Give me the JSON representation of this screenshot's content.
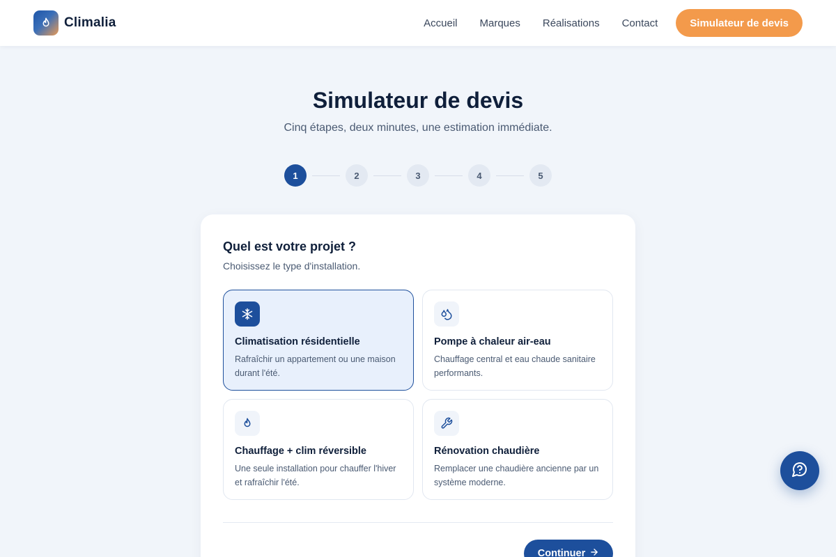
{
  "header": {
    "brand": "Climalia",
    "nav": [
      "Accueil",
      "Marques",
      "Réalisations",
      "Contact"
    ],
    "cta": "Simulateur de devis"
  },
  "hero": {
    "title": "Simulateur de devis",
    "subtitle": "Cinq étapes, deux minutes, une estimation immédiate."
  },
  "stepper": {
    "steps": [
      "1",
      "2",
      "3",
      "4",
      "5"
    ],
    "current": 1
  },
  "form": {
    "question": "Quel est votre projet ?",
    "hint": "Choisissez le type d'installation.",
    "options": [
      {
        "icon": "snowflake-icon",
        "title": "Climatisation résidentielle",
        "desc": "Rafraîchir un appartement ou une maison durant l'été.",
        "selected": true
      },
      {
        "icon": "water-drops-icon",
        "title": "Pompe à chaleur air-eau",
        "desc": "Chauffage central et eau chaude sanitaire performants.",
        "selected": false
      },
      {
        "icon": "flame-icon",
        "title": "Chauffage + clim réversible",
        "desc": "Une seule installation pour chauffer l'hiver et rafraîchir l'été.",
        "selected": false
      },
      {
        "icon": "wrench-icon",
        "title": "Rénovation chaudière",
        "desc": "Remplacer une chaudière ancienne par un système moderne.",
        "selected": false
      }
    ],
    "continue": "Continuer"
  },
  "help_button": {
    "icon": "help-chat-icon"
  },
  "colors": {
    "primary": "#1d4f9c",
    "accent": "#f39a4b",
    "background": "#f1f5fa"
  }
}
